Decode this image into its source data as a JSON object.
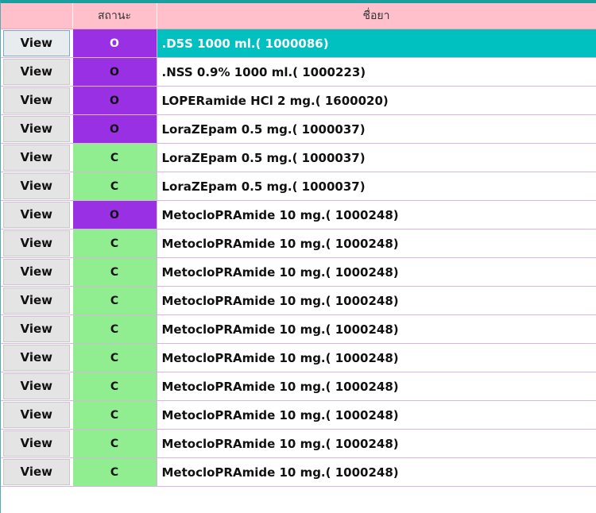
{
  "header": {
    "view_label": "",
    "status_label": "สถานะ",
    "drug_label": "ชื่อยา"
  },
  "colors": {
    "header_bg": "#ffc0cb",
    "status_open": "#9a30e3",
    "status_closed": "#90ee90",
    "selected_row": "#00c0c0"
  },
  "rows": [
    {
      "view": "View",
      "status": "O",
      "drug": ".D5S 1000 ml.( 1000086)",
      "selected": true
    },
    {
      "view": "View",
      "status": "O",
      "drug": ".NSS 0.9% 1000 ml.( 1000223)",
      "selected": false
    },
    {
      "view": "View",
      "status": "O",
      "drug": "LOPERamide HCl 2 mg.( 1600020)",
      "selected": false
    },
    {
      "view": "View",
      "status": "O",
      "drug": "LoraZEpam 0.5 mg.( 1000037)",
      "selected": false
    },
    {
      "view": "View",
      "status": "C",
      "drug": "LoraZEpam 0.5 mg.( 1000037)",
      "selected": false
    },
    {
      "view": "View",
      "status": "C",
      "drug": "LoraZEpam 0.5 mg.( 1000037)",
      "selected": false
    },
    {
      "view": "View",
      "status": "O",
      "drug": "MetocloPRAmide 10 mg.( 1000248)",
      "selected": false
    },
    {
      "view": "View",
      "status": "C",
      "drug": "MetocloPRAmide 10 mg.( 1000248)",
      "selected": false
    },
    {
      "view": "View",
      "status": "C",
      "drug": "MetocloPRAmide 10 mg.( 1000248)",
      "selected": false
    },
    {
      "view": "View",
      "status": "C",
      "drug": "MetocloPRAmide 10 mg.( 1000248)",
      "selected": false
    },
    {
      "view": "View",
      "status": "C",
      "drug": "MetocloPRAmide 10 mg.( 1000248)",
      "selected": false
    },
    {
      "view": "View",
      "status": "C",
      "drug": "MetocloPRAmide 10 mg.( 1000248)",
      "selected": false
    },
    {
      "view": "View",
      "status": "C",
      "drug": "MetocloPRAmide 10 mg.( 1000248)",
      "selected": false
    },
    {
      "view": "View",
      "status": "C",
      "drug": "MetocloPRAmide 10 mg.( 1000248)",
      "selected": false
    },
    {
      "view": "View",
      "status": "C",
      "drug": "MetocloPRAmide 10 mg.( 1000248)",
      "selected": false
    },
    {
      "view": "View",
      "status": "C",
      "drug": "MetocloPRAmide 10 mg.( 1000248)",
      "selected": false
    }
  ]
}
